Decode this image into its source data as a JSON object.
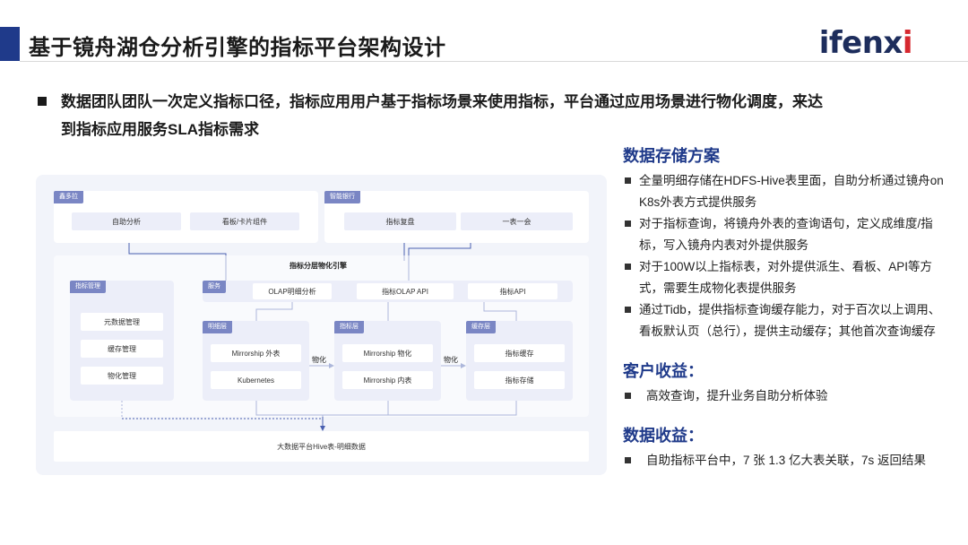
{
  "header": {
    "title": "基于镜舟湖仓分析引擎的指标平台架构设计",
    "logo_main": "ifenx",
    "logo_accent": "i"
  },
  "lead": {
    "line1": "数据团队团队一次定义指标口径，指标应用用户基于指标场景来使用指标，平台通过应用场景进行物化调度，来达",
    "line2": "到指标应用服务SLA指标需求"
  },
  "storage": {
    "title": "数据存储方案",
    "items": [
      "全量明细存储在HDFS-Hive表里面，自助分析通过镜舟on K8s外表方式提供服务",
      "对于指标查询，将镜舟外表的查询语句，定义成维度/指标，写入镜舟内表对外提供服务",
      "对于100W以上指标表，对外提供派生、看板、API等方式，需要生成物化表提供服务",
      "通过Tidb，提供指标查询缓存能力，对于百次以上调用、看板默认页（总行），提供主动缓存；其他首次查询缓存"
    ]
  },
  "customer": {
    "title": "客户收益：",
    "items": [
      "高效查询，提升业务自助分析体验"
    ]
  },
  "databenefit": {
    "title": "数据收益：",
    "items": [
      "自助指标平台中，7 张 1.3 亿大表关联，7s 返回结果"
    ]
  },
  "diagram": {
    "app_left": {
      "tag": "鑫多拉",
      "boxes": [
        "自助分析",
        "看板/卡片组件"
      ]
    },
    "app_right": {
      "tag": "智能银行",
      "boxes": [
        "指标复盘",
        "一表一会"
      ]
    },
    "engine_title": "指标分层物化引擎",
    "mgmt": {
      "tag": "指标管理",
      "boxes": [
        "元数据管理",
        "缓存管理",
        "物化管理"
      ]
    },
    "service": {
      "tag": "服务",
      "boxes": [
        "OLAP明细分析",
        "指标OLAP API",
        "指标API"
      ]
    },
    "detail": {
      "tag": "明细层",
      "boxes": [
        "Mirrorship 外表",
        "Kubernetes"
      ]
    },
    "metric": {
      "tag": "指标层",
      "boxes": [
        "Mirrorship 物化",
        "Mirrorship 内表"
      ]
    },
    "cache": {
      "tag": "缓存层",
      "boxes": [
        "指标缓存",
        "指标存储"
      ]
    },
    "arrow1": "物化",
    "arrow2": "物化",
    "bottom": "大数据平台Hive表-明细数据"
  },
  "colors": {
    "accent": "#1f3a8a",
    "logo_red": "#d6282f",
    "tag": "#7a86c4",
    "box": "#eceef9",
    "diagram_bg": "#f2f4fa",
    "line": "#4a5fb0"
  }
}
